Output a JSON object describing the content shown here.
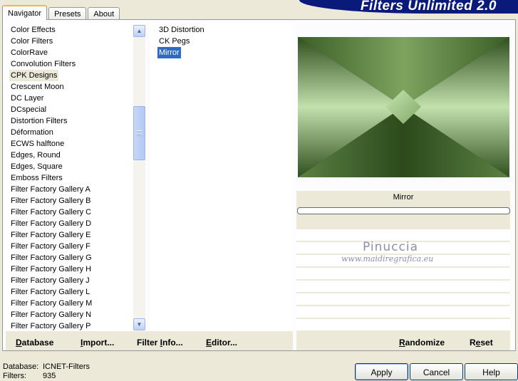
{
  "tabs": [
    {
      "label": "Navigator",
      "active": true
    },
    {
      "label": "Presets",
      "active": false
    },
    {
      "label": "About",
      "active": false
    }
  ],
  "banner": {
    "title": "Filters Unlimited 2.0",
    "color": "#0a1a7a"
  },
  "categories": {
    "selected": "CPK Designs",
    "items": [
      "Color Effects",
      "Color Filters",
      "ColorRave",
      "Convolution Filters",
      "CPK Designs",
      "Crescent Moon",
      "DC Layer",
      "DCspecial",
      "Distortion Filters",
      "Déformation",
      "ECWS halftone",
      "Edges, Round",
      "Edges, Square",
      "Emboss Filters",
      "Filter Factory Gallery A",
      "Filter Factory Gallery B",
      "Filter Factory Gallery C",
      "Filter Factory Gallery D",
      "Filter Factory Gallery E",
      "Filter Factory Gallery F",
      "Filter Factory Gallery G",
      "Filter Factory Gallery H",
      "Filter Factory Gallery J",
      "Filter Factory Gallery L",
      "Filter Factory Gallery M",
      "Filter Factory Gallery N",
      "Filter Factory Gallery P"
    ],
    "scroll_up_icon": "arrow-up-icon",
    "scroll_down_icon": "arrow-down-icon"
  },
  "filters": {
    "selected": "Mirror",
    "items": [
      "3D Distortion",
      "CK Pegs",
      "Mirror"
    ]
  },
  "preview": {
    "filter_name": "Mirror",
    "progress": 0,
    "colors": {
      "dark": "#2c4a1c",
      "mid": "#5a7e3e",
      "light": "#b0d49a"
    }
  },
  "watermark": {
    "name": "Pinuccia",
    "url": "www.maidiregrafica.eu"
  },
  "bottom_left": {
    "database": {
      "pre": "",
      "u": "D",
      "post": "atabase"
    },
    "import": {
      "pre": "",
      "u": "I",
      "post": "mport..."
    },
    "filter_info": {
      "pre": "Filter ",
      "u": "I",
      "post": "nfo..."
    },
    "editor": {
      "pre": "",
      "u": "E",
      "post": "ditor..."
    }
  },
  "bottom_right": {
    "randomize": {
      "pre": "",
      "u": "R",
      "post": "andomize"
    },
    "reset": {
      "pre": "R",
      "u": "e",
      "post": "set"
    }
  },
  "status": {
    "database_label": "Database:",
    "database_value": "ICNET-Filters",
    "filters_label": "Filters:",
    "filters_value": "935"
  },
  "buttons": {
    "apply": "Apply",
    "cancel": "Cancel",
    "help": "Help"
  }
}
